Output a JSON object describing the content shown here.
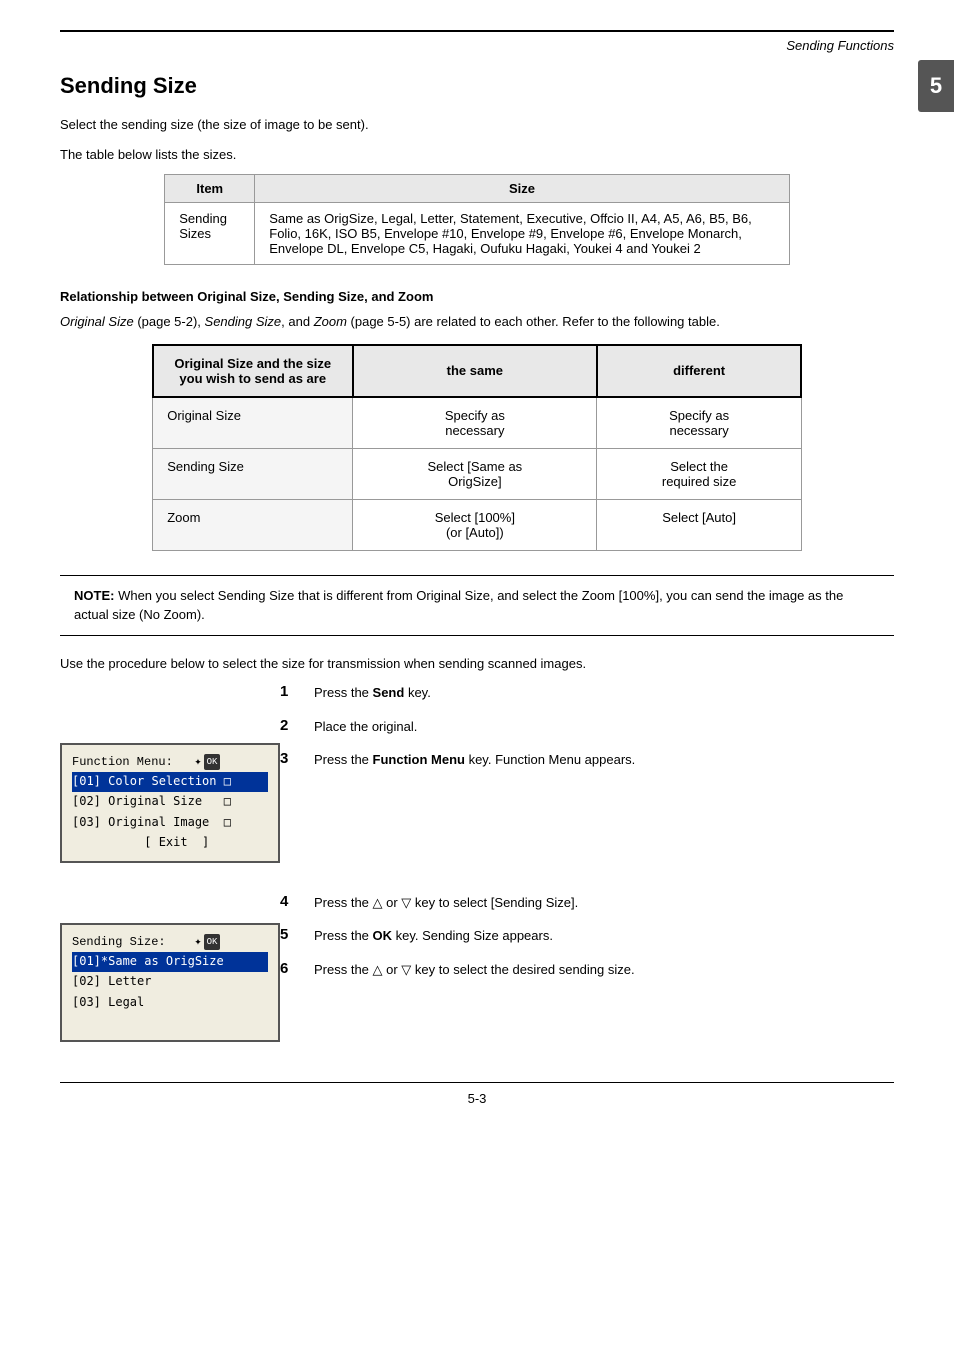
{
  "header": {
    "title": "Sending Functions",
    "chapter_num": "5"
  },
  "page_title": "Sending Size",
  "intro_text_1": "Select the sending size (the size of image to be sent).",
  "intro_text_2": "The table below lists the sizes.",
  "main_table": {
    "headers": [
      "Item",
      "Size"
    ],
    "rows": [
      {
        "item": "Sending\nSizes",
        "size": "Same as OrigSize, Legal, Letter, Statement, Executive, Offcio II, A4, A5, A6, B5, B6, Folio, 16K, ISO B5, Envelope #10, Envelope #9, Envelope #6, Envelope Monarch, Envelope DL, Envelope C5, Hagaki, Oufuku Hagaki, Youkei 4 and Youkei 2"
      }
    ]
  },
  "relationship_section": {
    "heading": "Relationship between Original Size, Sending Size, and Zoom",
    "intro": "Original Size (page 5-2), Sending Size, and Zoom (page 5-5) are related to each other. Refer to the following table.",
    "table": {
      "col1_header": "Original Size and the size you wish to send as are",
      "col2_header": "the same",
      "col3_header": "different",
      "rows": [
        {
          "label": "Original Size",
          "same": "Specify as\nnecessary",
          "different": "Specify as\nnecessary"
        },
        {
          "label": "Sending Size",
          "same": "Select [Same as\nOrigSize]",
          "different": "Select the\nrequired size"
        },
        {
          "label": "Zoom",
          "same": "Select [100%]\n(or [Auto])",
          "different": "Select [Auto]"
        }
      ]
    }
  },
  "note": {
    "label": "NOTE:",
    "text": "When you select Sending Size that is different from Original Size, and select the Zoom [100%], you can send the image as the actual size (No Zoom)."
  },
  "procedure_intro": "Use the procedure below to select the size for transmission when sending scanned images.",
  "steps": [
    {
      "num": "1",
      "text": "Press the ",
      "bold": "Send",
      "text2": " key."
    },
    {
      "num": "2",
      "text": "Place the original.",
      "bold": "",
      "text2": ""
    },
    {
      "num": "3",
      "text": "Press the ",
      "bold": "Function Menu",
      "text2": " key. Function Menu appears."
    },
    {
      "num": "4",
      "text": "Press the △ or ▽ key to select [Sending Size].",
      "bold": "",
      "text2": ""
    },
    {
      "num": "5",
      "text": "Press the ",
      "bold": "OK",
      "text2": " key. Sending Size appears."
    },
    {
      "num": "6",
      "text": "Press the △ or ▽ key to select the desired sending size.",
      "bold": "",
      "text2": ""
    }
  ],
  "lcd1": {
    "title": "Function Menu:   ✦OK",
    "lines": [
      {
        "num": "01",
        "text": " Color Selection  □",
        "highlighted": true
      },
      {
        "num": "02",
        "text": " Original Size    □",
        "highlighted": false
      },
      {
        "num": "03",
        "text": " Original Image   □",
        "highlighted": false
      },
      {
        "num": "",
        "text": "          [ Exit  ]",
        "highlighted": false
      }
    ]
  },
  "lcd2": {
    "title": "Sending Size:    ✦OK",
    "lines": [
      {
        "num": "01",
        "text": "*Same as OrigSize",
        "highlighted": true
      },
      {
        "num": "02",
        "text": " Letter",
        "highlighted": false
      },
      {
        "num": "03",
        "text": " Legal",
        "highlighted": false
      }
    ]
  },
  "page_num": "5-3"
}
